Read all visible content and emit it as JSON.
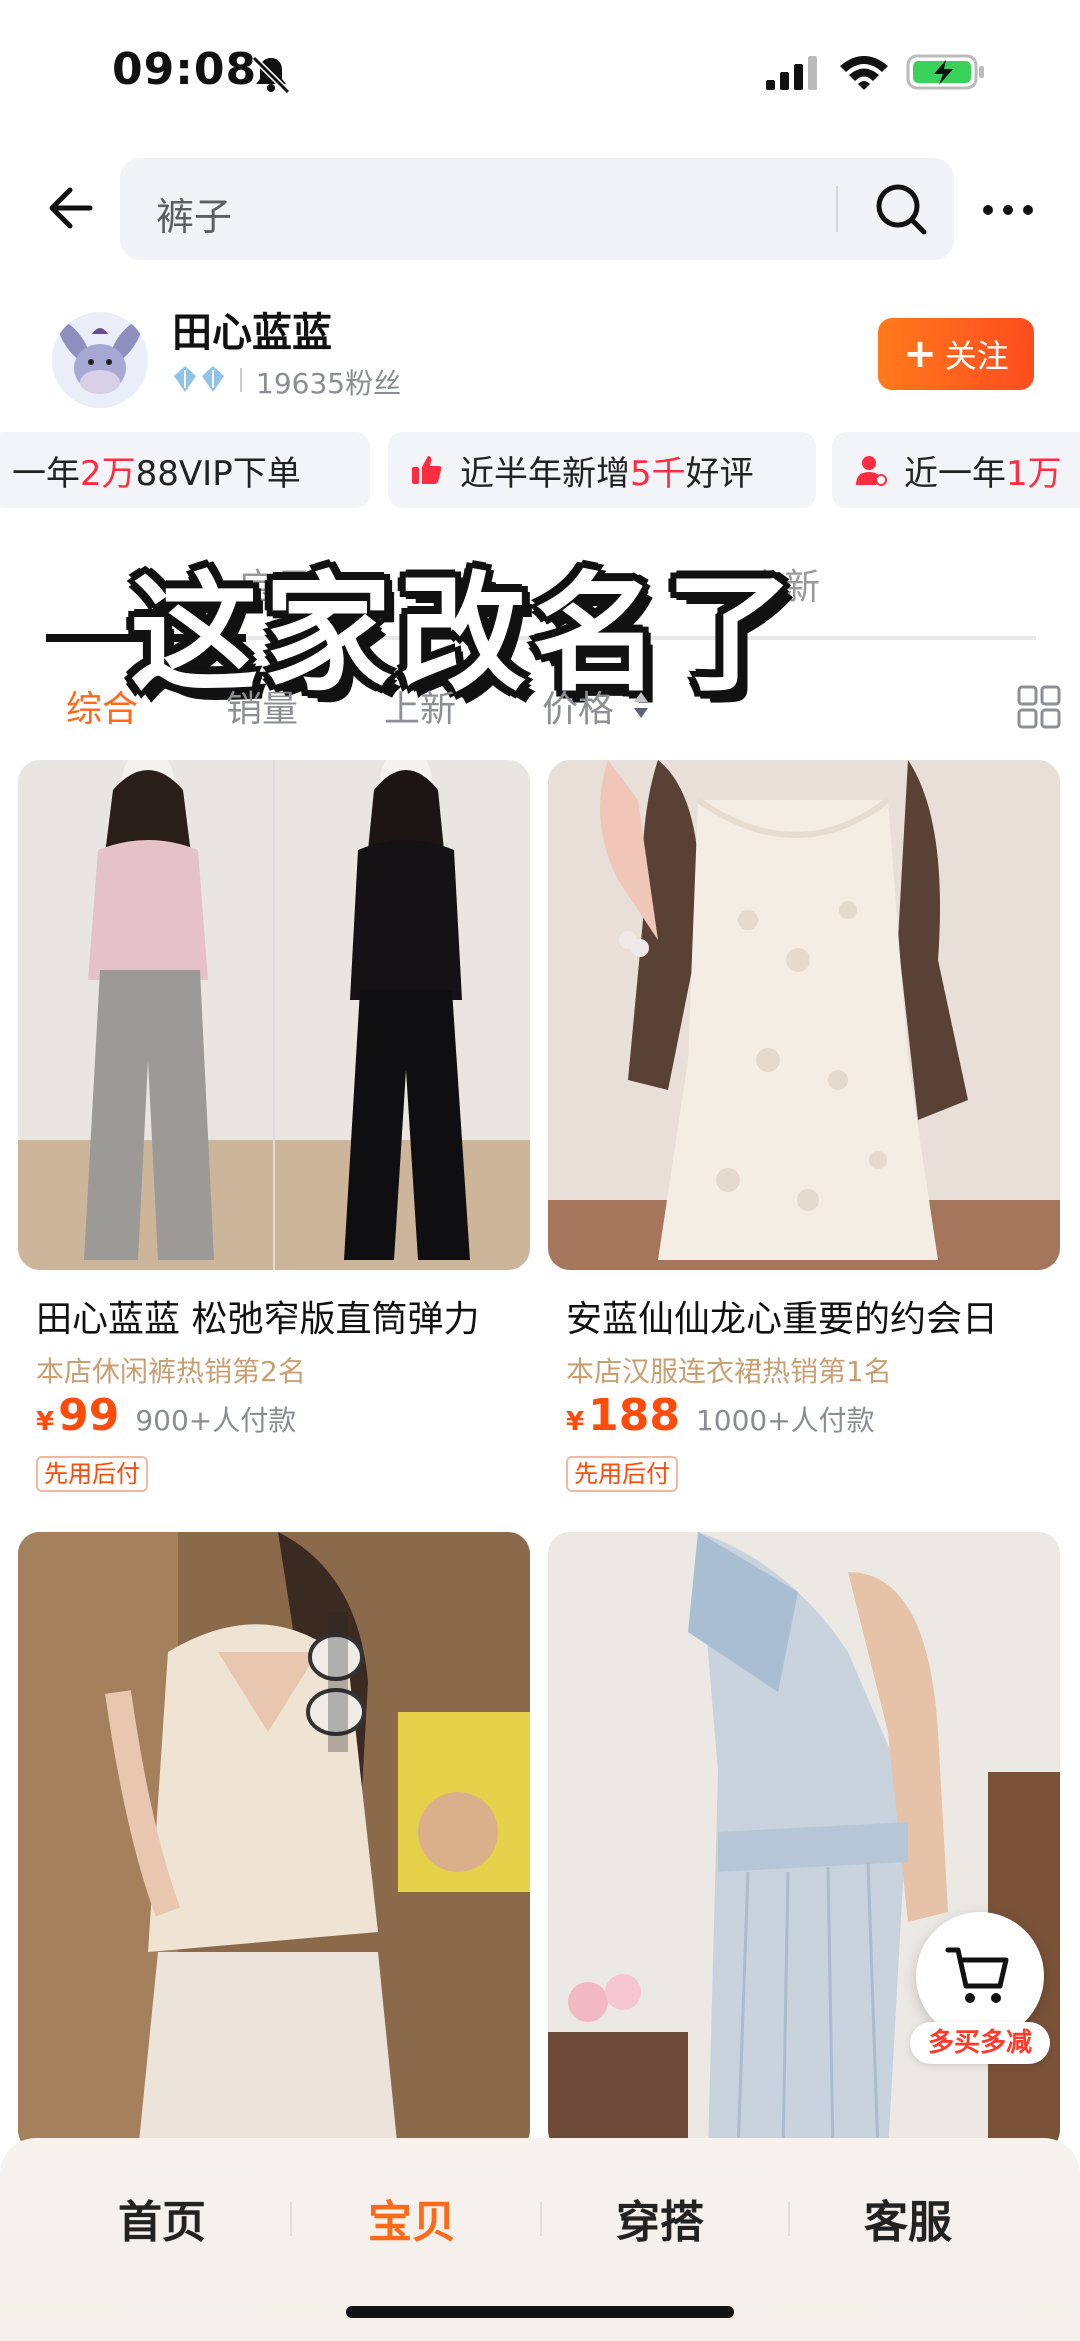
{
  "status_bar": {
    "time": "09:08"
  },
  "search": {
    "query": "裤子"
  },
  "store": {
    "name": "田心蓝蓝",
    "fans": "19635粉丝",
    "follow_label": "关注",
    "follow_plus": "+"
  },
  "chips": [
    {
      "pre": "一年",
      "red": "2万",
      "post": "88VIP下单",
      "icon": "none"
    },
    {
      "pre": "近半年新增",
      "red": "5千",
      "post": "好评",
      "icon": "thumbs-up-icon"
    },
    {
      "pre": "近一年",
      "red": "1万",
      "post": "",
      "icon": "user-icon"
    }
  ],
  "overlay": {
    "caption": "这家改名了",
    "tab_fragment_1": "宝贝",
    "tab_fragment_2": "上新"
  },
  "sort_tabs": [
    {
      "label": "综合",
      "active": true
    },
    {
      "label": "销量",
      "active": false
    },
    {
      "label": "上新",
      "active": false
    },
    {
      "label": "价格",
      "active": false
    }
  ],
  "products": [
    {
      "title": "田心蓝蓝 松弛窄版直筒弹力",
      "rank": "本店休闲裤热销第2名",
      "currency": "¥",
      "price": "99",
      "sold": "900+人付款",
      "tag": "先用后付"
    },
    {
      "title": "安蓝仙仙龙心重要的约会日",
      "rank": "本店汉服连衣裙热销第1名",
      "currency": "¥",
      "price": "188",
      "sold": "1000+人付款",
      "tag": "先用后付"
    },
    {
      "title": "",
      "rank": "",
      "currency": "",
      "price": "",
      "sold": "",
      "tag": ""
    },
    {
      "title": "",
      "rank": "",
      "currency": "",
      "price": "",
      "sold": "",
      "tag": ""
    }
  ],
  "cart_float": {
    "label": "多买多减"
  },
  "bottom_nav": [
    {
      "label": "首页",
      "active": false
    },
    {
      "label": "宝贝",
      "active": true
    },
    {
      "label": "穿搭",
      "active": false
    },
    {
      "label": "客服",
      "active": false
    }
  ],
  "colors": {
    "accent": "#ff6a1a",
    "price": "#ff4c0a",
    "chip_highlight": "#ff2d3f"
  }
}
